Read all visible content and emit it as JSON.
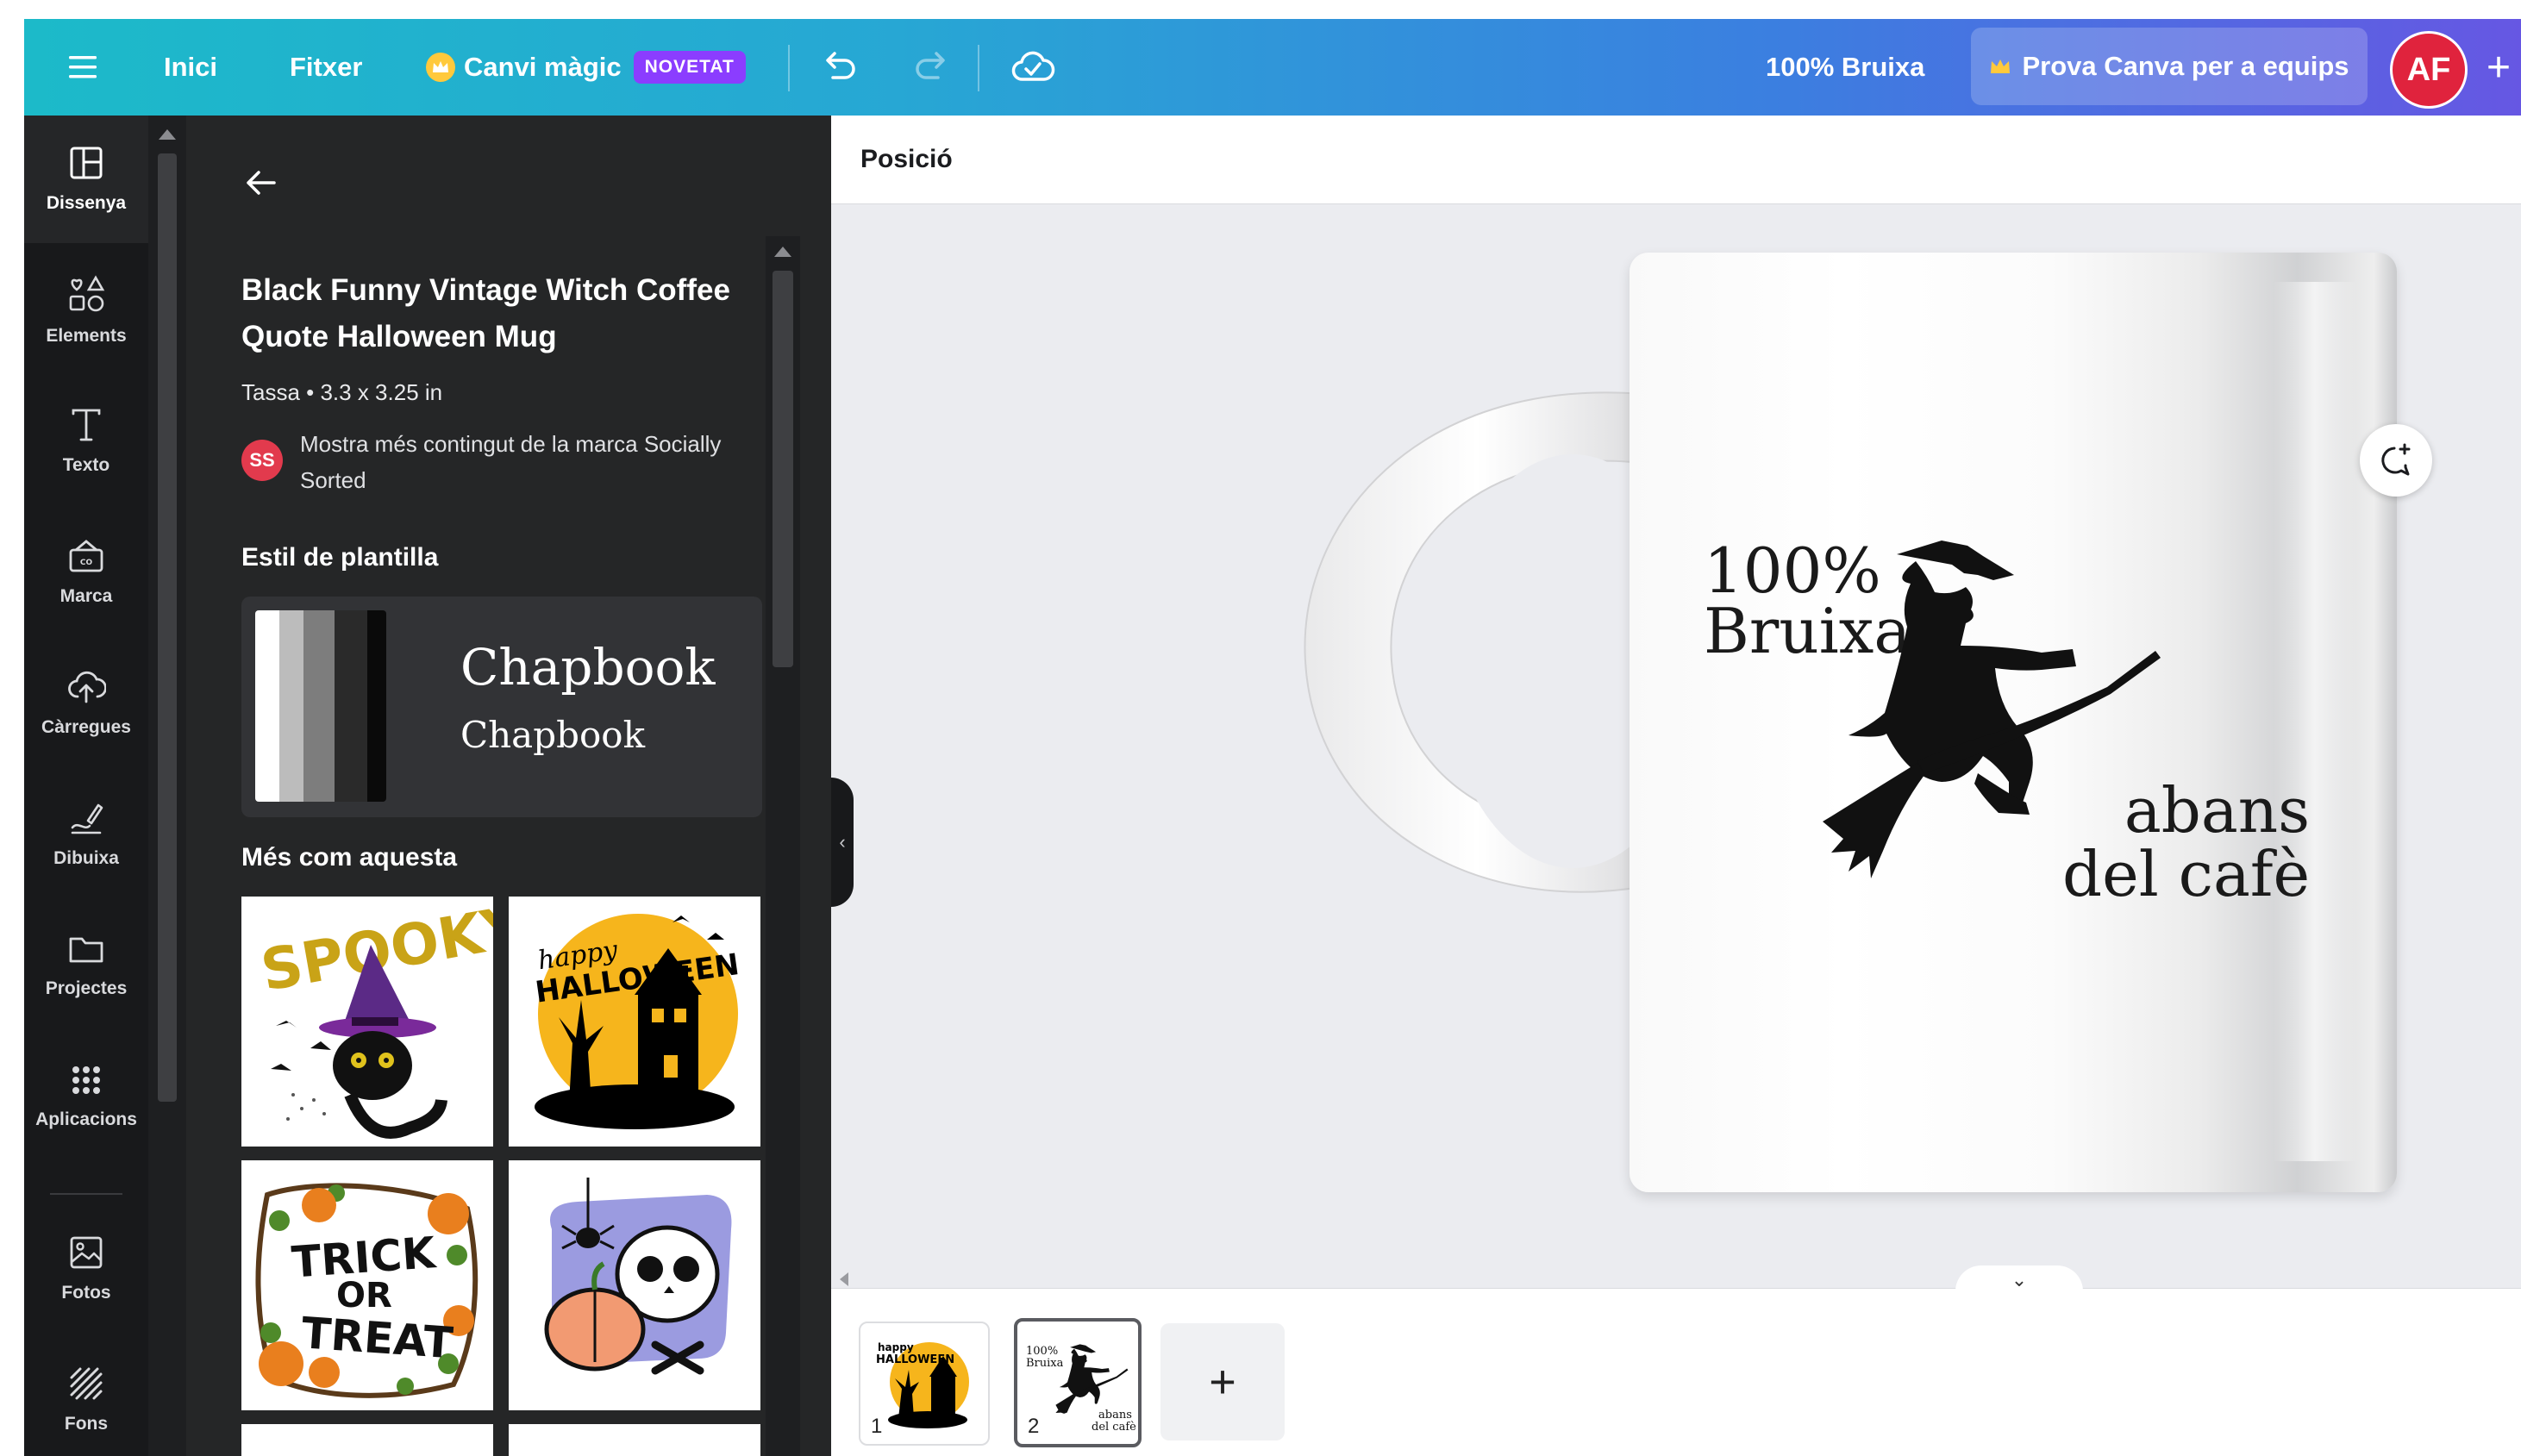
{
  "topbar": {
    "home": "Inici",
    "file": "Fitxer",
    "magic": "Canvi màgic",
    "magic_badge": "NOVETAT",
    "doc_title": "100% Bruixa",
    "teams_button": "Prova Canva per a equips",
    "avatar_initials": "AF",
    "plus": "+"
  },
  "rail": {
    "items": [
      {
        "label": "Dissenya",
        "icon": "layout-icon"
      },
      {
        "label": "Elements",
        "icon": "shapes-icon"
      },
      {
        "label": "Texto",
        "icon": "text-icon"
      },
      {
        "label": "Marca",
        "icon": "brand-kit-icon"
      },
      {
        "label": "Càrregues",
        "icon": "cloud-upload-icon"
      },
      {
        "label": "Dibuixa",
        "icon": "draw-icon"
      },
      {
        "label": "Projectes",
        "icon": "folder-icon"
      },
      {
        "label": "Aplicacions",
        "icon": "apps-grid-icon"
      },
      {
        "label": "Fotos",
        "icon": "image-icon"
      },
      {
        "label": "Fons",
        "icon": "background-hatch-icon"
      }
    ]
  },
  "panel": {
    "title": "Black Funny Vintage Witch Coffee Quote Halloween Mug",
    "meta": "Tassa • 3.3 x 3.25 in",
    "brand_initials": "SS",
    "brand_text": "Mostra més contingut de la marca Socially Sorted",
    "style_heading": "Estil de plantilla",
    "style_font_title": "Chapbook",
    "style_font_body": "Chapbook",
    "style_colors": [
      "#ffffff",
      "#bcbcbc",
      "#7d7d7d",
      "#2a2a2a",
      "#0a0a0a"
    ],
    "more_heading": "Més com aquesta"
  },
  "editor": {
    "position_label": "Posició",
    "mug_text_top_1": "100%",
    "mug_text_top_2": "Bruixa",
    "mug_text_bottom_1": "abans",
    "mug_text_bottom_2": "del cafè"
  },
  "pages": {
    "page1_number": "1",
    "page2_number": "2",
    "add_page": "+"
  }
}
